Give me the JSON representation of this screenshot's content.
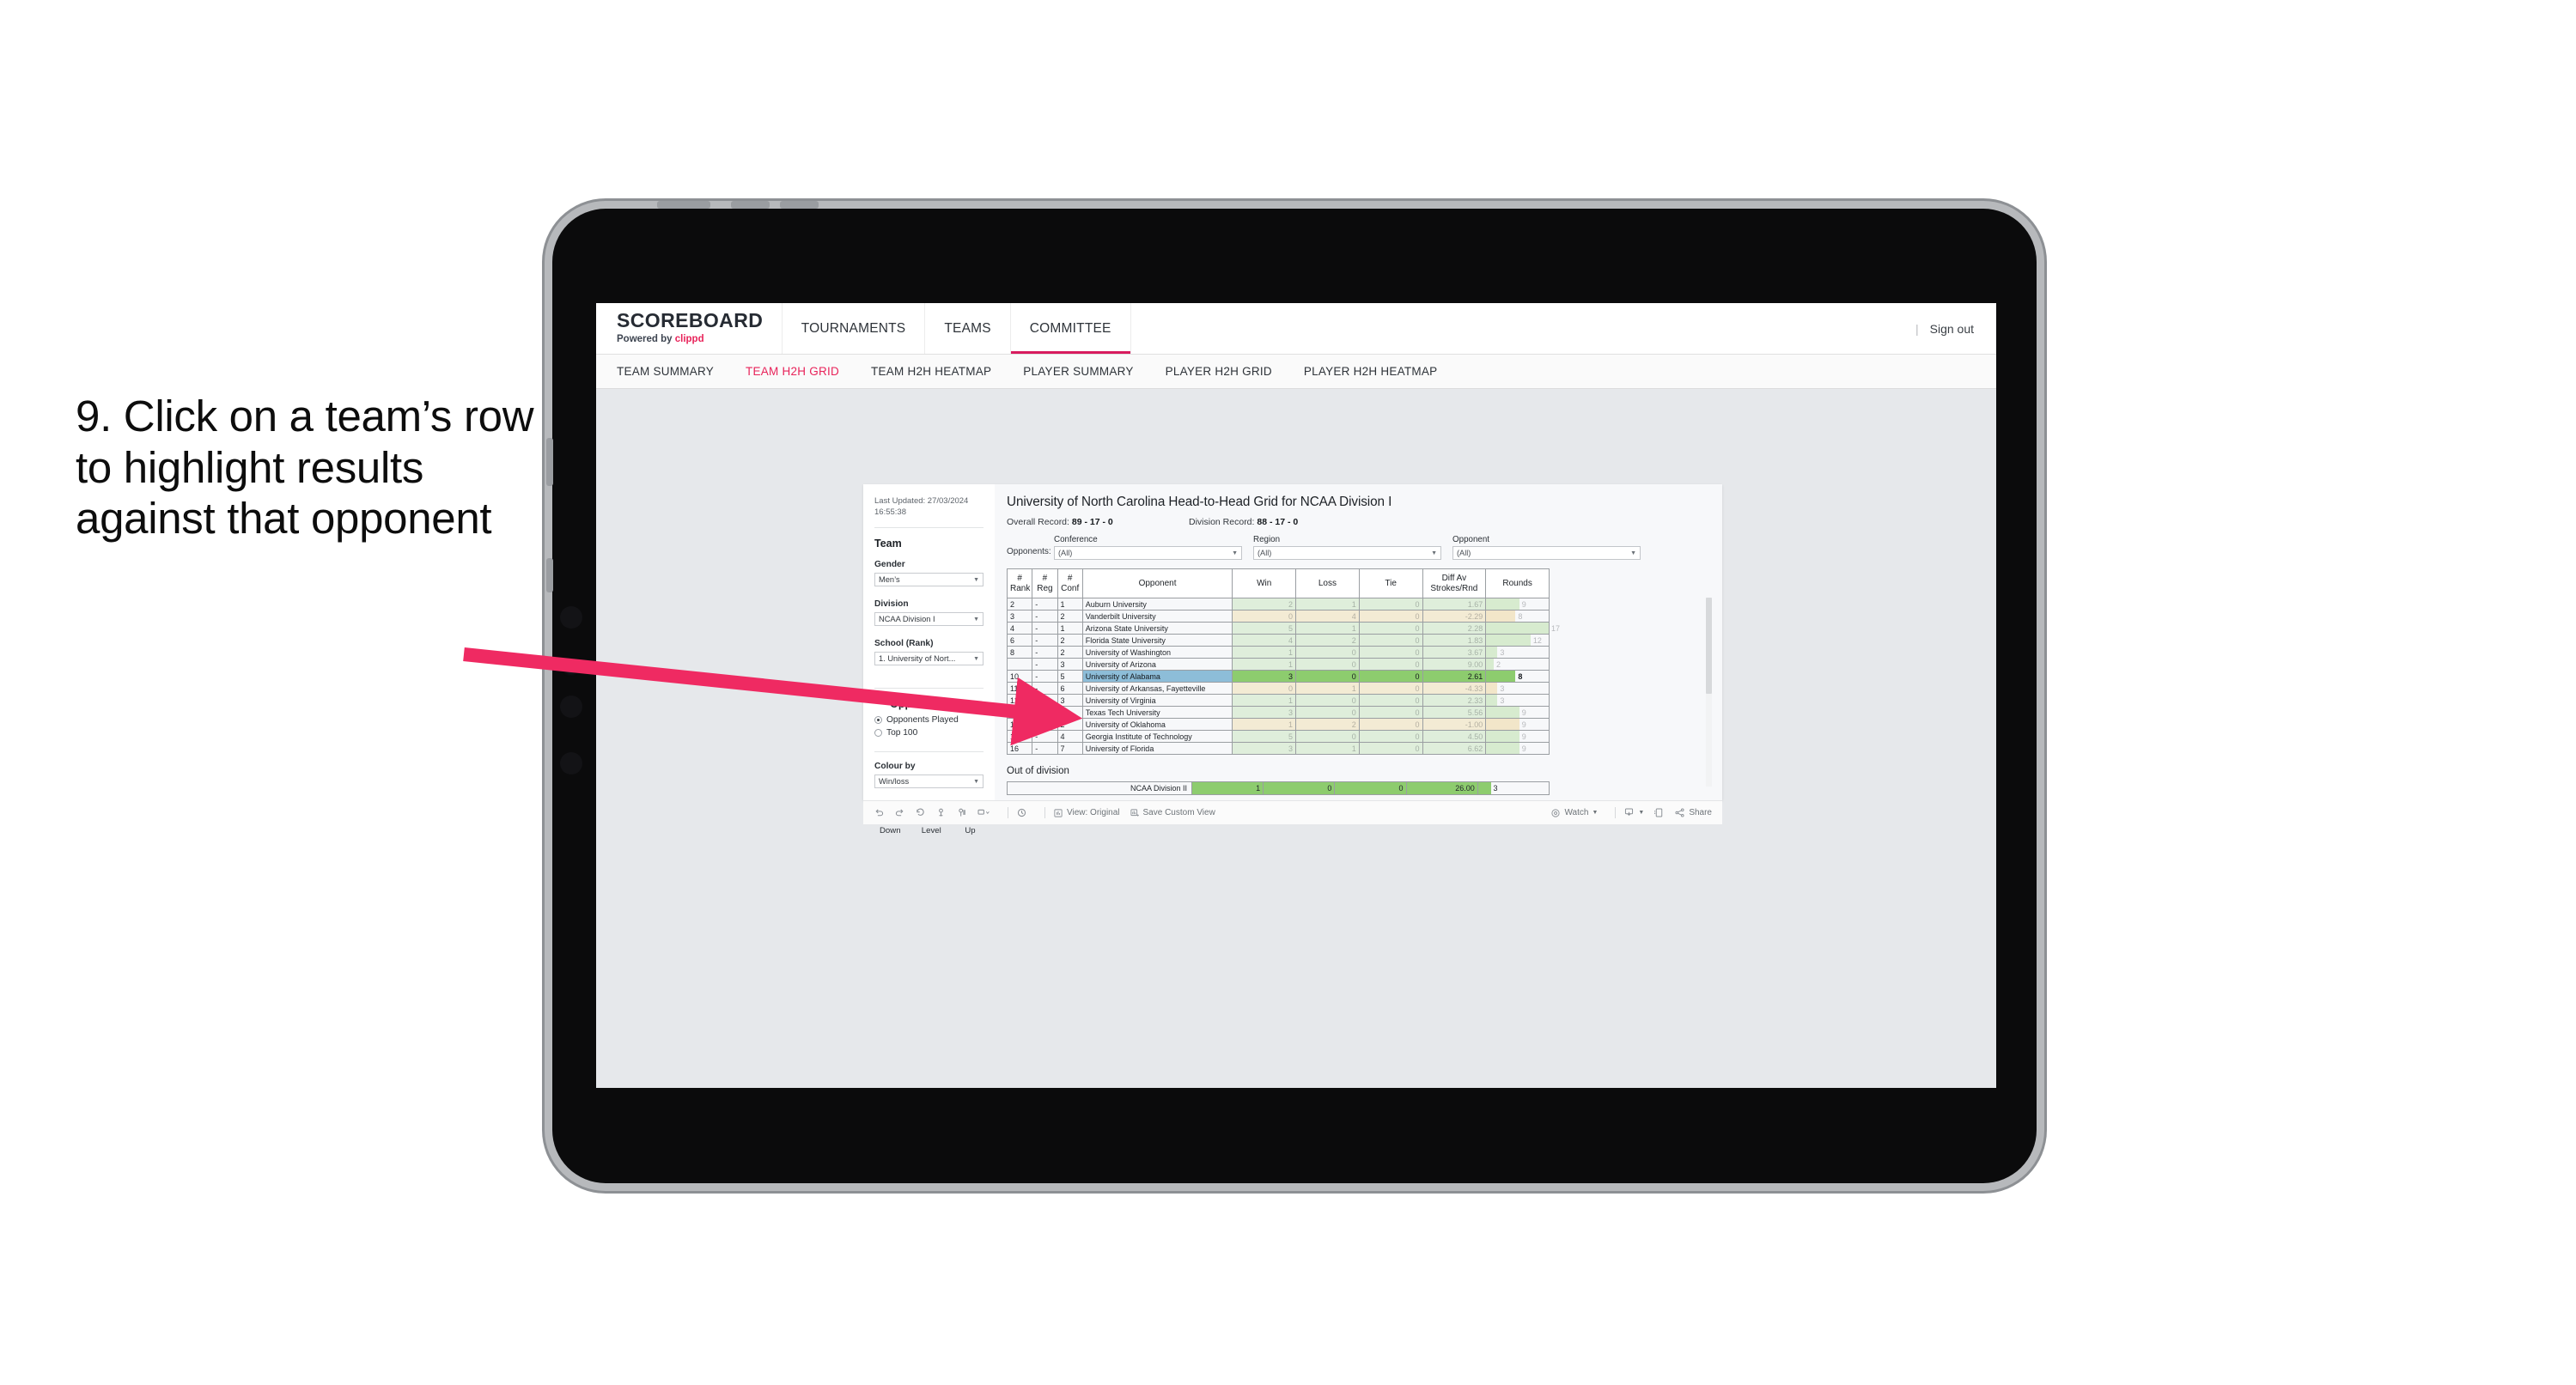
{
  "annotation": {
    "text": "9. Click on a team’s row to highlight results against that opponent",
    "arrow_color": "#ef2a62"
  },
  "app": {
    "brand": {
      "title": "SCOREBOARD",
      "powered_prefix": "Powered by ",
      "powered_name": "clippd"
    },
    "topnav": [
      {
        "label": "TOURNAMENTS",
        "active": false
      },
      {
        "label": "TEAMS",
        "active": false
      },
      {
        "label": "COMMITTEE",
        "active": true
      }
    ],
    "topnav_right": {
      "separator": "|",
      "sign_out": "Sign out"
    },
    "subnav": [
      {
        "label": "TEAM SUMMARY",
        "active": false
      },
      {
        "label": "TEAM H2H GRID",
        "active": true
      },
      {
        "label": "TEAM H2H HEATMAP",
        "active": false
      },
      {
        "label": "PLAYER SUMMARY",
        "active": false
      },
      {
        "label": "PLAYER H2H GRID",
        "active": false
      },
      {
        "label": "PLAYER H2H HEATMAP",
        "active": false
      }
    ]
  },
  "sidebar": {
    "last_updated": "Last Updated: 27/03/2024 16:55:38",
    "team_heading": "Team",
    "gender_label": "Gender",
    "gender_value": "Men’s",
    "division_label": "Division",
    "division_value": "NCAA Division I",
    "school_label": "School (Rank)",
    "school_value": "1. University of Nort...",
    "opponent_view_heading": "Opponent View",
    "opponent_view_options": [
      {
        "label": "Opponents Played",
        "selected": true
      },
      {
        "label": "Top 100",
        "selected": false
      }
    ],
    "colour_by_label": "Colour by",
    "colour_by_value": "Win/loss",
    "legend": [
      {
        "label": "Down",
        "color": "#f0cf4a"
      },
      {
        "label": "Level",
        "color": "#c6c9ce"
      },
      {
        "label": "Up",
        "color": "#8dc85a"
      }
    ]
  },
  "main": {
    "title": "University of North Carolina Head-to-Head Grid for NCAA Division I",
    "overall_record_label": "Overall Record: ",
    "overall_record_value": "89 - 17 - 0",
    "division_record_label": "Division Record: ",
    "division_record_value": "88 - 17 - 0",
    "filters_lead": "Opponents:",
    "filters": [
      {
        "label": "Conference",
        "value": "(All)"
      },
      {
        "label": "Region",
        "value": "(All)"
      },
      {
        "label": "Opponent",
        "value": "(All)"
      }
    ],
    "out_of_division_title": "Out of division",
    "out_of_division_row": {
      "label": "NCAA Division II",
      "win": "1",
      "loss": "0",
      "tie": "0",
      "diff": "26.00",
      "rounds": "3",
      "rounds_pct": 18
    }
  },
  "table": {
    "headers": {
      "rank": "#\nRank",
      "reg": "#\nReg",
      "conf": "#\nConf",
      "opponent": "Opponent",
      "win": "Win",
      "loss": "Loss",
      "tie": "Tie",
      "diff": "Diff Av\nStrokes/Rnd",
      "rounds": "Rounds"
    },
    "header_labels": [
      "# Rank",
      "# Reg",
      "# Conf",
      "Opponent",
      "Win",
      "Loss",
      "Tie",
      "Diff Av Strokes/Rnd",
      "Rounds"
    ],
    "rows": [
      {
        "rank": "2",
        "reg": "-",
        "conf": "1",
        "opponent": "Auburn University",
        "win": "2",
        "loss": "1",
        "tie": "0",
        "diff": "1.67",
        "rounds": "9",
        "rounds_pct": 53,
        "result": "win",
        "selected": false
      },
      {
        "rank": "3",
        "reg": "-",
        "conf": "2",
        "opponent": "Vanderbilt University",
        "win": "0",
        "loss": "4",
        "tie": "0",
        "diff": "-2.29",
        "rounds": "8",
        "rounds_pct": 47,
        "result": "loss",
        "selected": false
      },
      {
        "rank": "4",
        "reg": "-",
        "conf": "1",
        "opponent": "Arizona State University",
        "win": "5",
        "loss": "1",
        "tie": "0",
        "diff": "2.28",
        "rounds": "17",
        "rounds_pct": 100,
        "result": "win",
        "selected": false
      },
      {
        "rank": "6",
        "reg": "-",
        "conf": "2",
        "opponent": "Florida State University",
        "win": "4",
        "loss": "2",
        "tie": "0",
        "diff": "1.83",
        "rounds": "12",
        "rounds_pct": 71,
        "result": "win",
        "selected": false
      },
      {
        "rank": "8",
        "reg": "-",
        "conf": "2",
        "opponent": "University of Washington",
        "win": "1",
        "loss": "0",
        "tie": "0",
        "diff": "3.67",
        "rounds": "3",
        "rounds_pct": 18,
        "result": "win",
        "selected": false
      },
      {
        "rank": "",
        "reg": "-",
        "conf": "3",
        "opponent": "University of Arizona",
        "win": "1",
        "loss": "0",
        "tie": "0",
        "diff": "9.00",
        "rounds": "2",
        "rounds_pct": 12,
        "result": "win",
        "selected": false
      },
      {
        "rank": "10",
        "reg": "-",
        "conf": "5",
        "opponent": "University of Alabama",
        "win": "3",
        "loss": "0",
        "tie": "0",
        "diff": "2.61",
        "rounds": "8",
        "rounds_pct": 47,
        "result": "win",
        "selected": true
      },
      {
        "rank": "11",
        "reg": "-",
        "conf": "6",
        "opponent": "University of Arkansas, Fayetteville",
        "win": "0",
        "loss": "1",
        "tie": "0",
        "diff": "-4.33",
        "rounds": "3",
        "rounds_pct": 18,
        "result": "loss",
        "selected": false
      },
      {
        "rank": "12",
        "reg": "-",
        "conf": "3",
        "opponent": "University of Virginia",
        "win": "1",
        "loss": "0",
        "tie": "0",
        "diff": "2.33",
        "rounds": "3",
        "rounds_pct": 18,
        "result": "win",
        "selected": false
      },
      {
        "rank": "13",
        "reg": "-",
        "conf": "1",
        "opponent": "Texas Tech University",
        "win": "3",
        "loss": "0",
        "tie": "0",
        "diff": "5.56",
        "rounds": "9",
        "rounds_pct": 53,
        "result": "win",
        "selected": false
      },
      {
        "rank": "14",
        "reg": "-",
        "conf": "2",
        "opponent": "University of Oklahoma",
        "win": "1",
        "loss": "2",
        "tie": "0",
        "diff": "-1.00",
        "rounds": "9",
        "rounds_pct": 53,
        "result": "loss",
        "selected": false
      },
      {
        "rank": "15",
        "reg": "-",
        "conf": "4",
        "opponent": "Georgia Institute of Technology",
        "win": "5",
        "loss": "0",
        "tie": "0",
        "diff": "4.50",
        "rounds": "9",
        "rounds_pct": 53,
        "result": "win",
        "selected": false
      },
      {
        "rank": "16",
        "reg": "-",
        "conf": "7",
        "opponent": "University of Florida",
        "win": "3",
        "loss": "1",
        "tie": "0",
        "diff": "6.62",
        "rounds": "9",
        "rounds_pct": 53,
        "result": "win",
        "selected": false
      }
    ]
  },
  "toolbar": {
    "items": [
      {
        "name": "undo-icon",
        "label": ""
      },
      {
        "name": "redo-icon",
        "label": ""
      },
      {
        "name": "revert-icon",
        "label": ""
      },
      {
        "name": "refresh-icon",
        "label": ""
      },
      {
        "name": "pause-icon",
        "label": ""
      },
      {
        "name": "shape-icon",
        "label": ""
      },
      {
        "name": "history-icon",
        "label": ""
      }
    ],
    "view_original": "View: Original",
    "save_custom_view": "Save Custom View",
    "watch": "Watch",
    "share": "Share"
  }
}
